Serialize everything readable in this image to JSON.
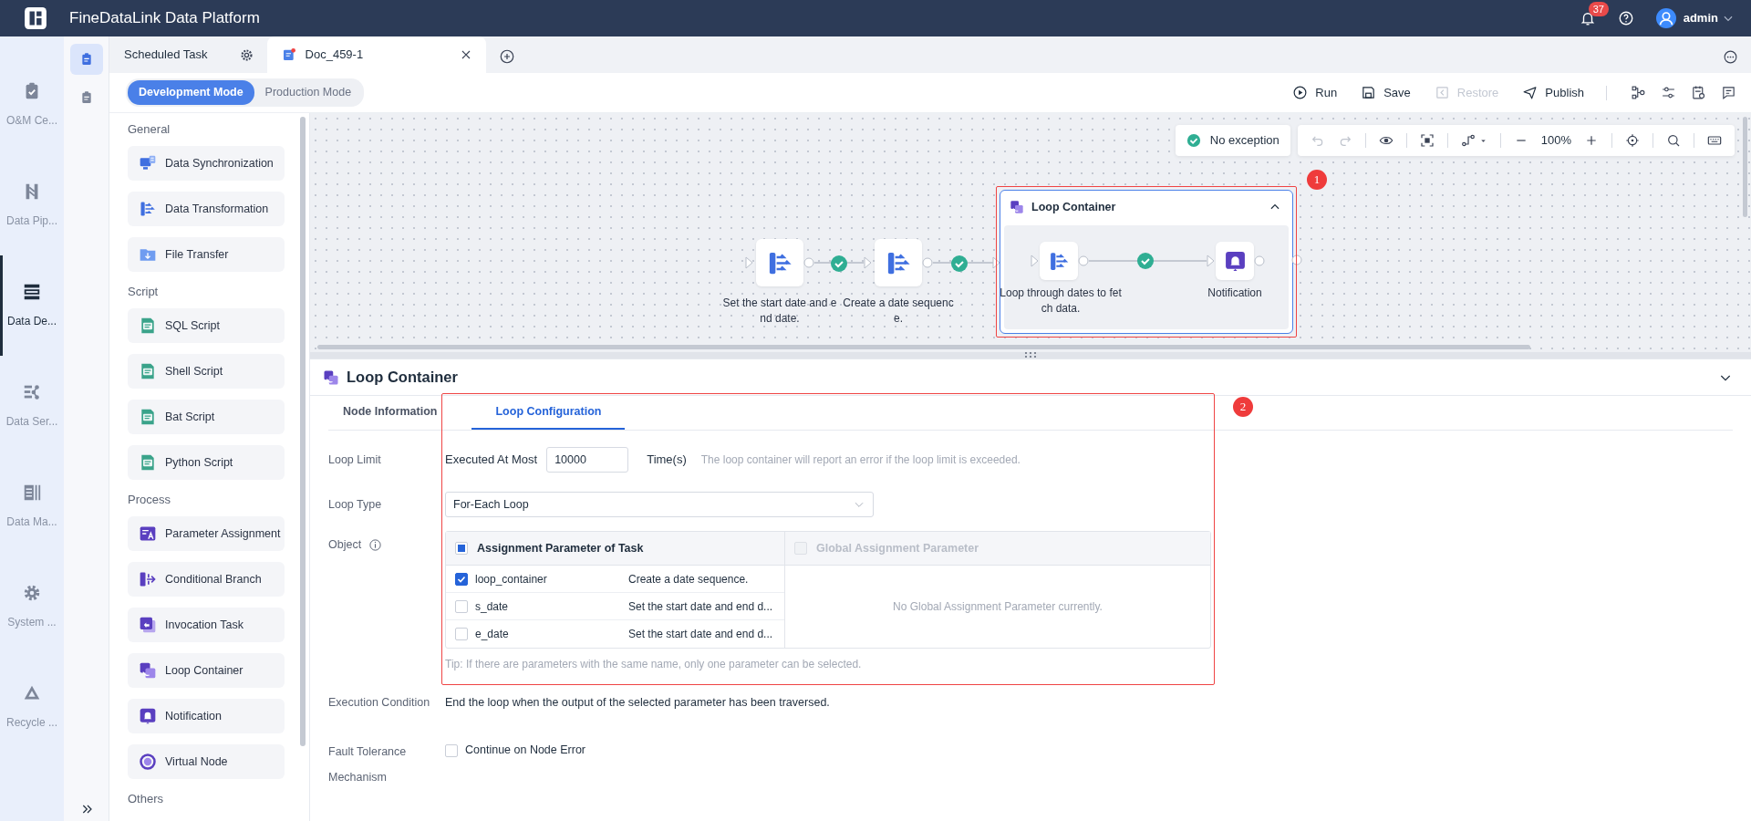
{
  "app": {
    "title": "FineDataLink Data Platform",
    "notification_count": "37",
    "user": "admin"
  },
  "nav": [
    {
      "label": "O&M Ce...",
      "kind": "clipboard",
      "selected": false
    },
    {
      "label": "Data Pip...",
      "kind": "pipeline",
      "selected": false
    },
    {
      "label": "Data De...",
      "kind": "develop",
      "selected": true
    },
    {
      "label": "Data Ser...",
      "kind": "service",
      "selected": false
    },
    {
      "label": "Data Ma...",
      "kind": "columns",
      "selected": false
    },
    {
      "label": "System ...",
      "kind": "gear",
      "selected": false
    },
    {
      "label": "Recycle ...",
      "kind": "recycle",
      "selected": false
    }
  ],
  "rail": [
    {
      "selected": true
    },
    {
      "selected": false
    }
  ],
  "tabs": [
    {
      "label": "Scheduled Task",
      "kind": "settings",
      "selected": false,
      "closable": false
    },
    {
      "label": "Doc_459-1",
      "kind": "document",
      "selected": true,
      "closable": true
    }
  ],
  "modes": [
    {
      "label": "Development Mode",
      "selected": true
    },
    {
      "label": "Production Mode",
      "selected": false
    }
  ],
  "actions": [
    {
      "label": "Run",
      "kind": "run",
      "disabled": false
    },
    {
      "label": "Save",
      "kind": "save",
      "disabled": false
    },
    {
      "label": "Restore",
      "kind": "restore",
      "disabled": true
    },
    {
      "label": "Publish",
      "kind": "publish",
      "disabled": false
    }
  ],
  "palette": [
    {
      "heading": "General",
      "items": [
        {
          "label": "Data Synchronization",
          "kind": "sync"
        },
        {
          "label": "Data Transformation",
          "kind": "transform"
        },
        {
          "label": "File Transfer",
          "kind": "file"
        }
      ]
    },
    {
      "heading": "Script",
      "items": [
        {
          "label": "SQL Script",
          "kind": "script"
        },
        {
          "label": "Shell Script",
          "kind": "script"
        },
        {
          "label": "Bat Script",
          "kind": "script"
        },
        {
          "label": "Python Script",
          "kind": "script"
        }
      ]
    },
    {
      "heading": "Process",
      "items": [
        {
          "label": "Parameter Assignment",
          "kind": "param"
        },
        {
          "label": "Conditional Branch",
          "kind": "branch"
        },
        {
          "label": "Invocation Task",
          "kind": "invoke"
        },
        {
          "label": "Loop Container",
          "kind": "loop"
        },
        {
          "label": "Notification",
          "kind": "notify"
        },
        {
          "label": "Virtual Node",
          "kind": "virtual"
        }
      ]
    },
    {
      "heading": "Others"
    }
  ],
  "canvas": {
    "status": "No exception",
    "zoom": "100%",
    "nodes": [
      {
        "label": "Set the start date and end date.",
        "kind": "transform"
      },
      {
        "label": "Create a date sequence.",
        "kind": "transform"
      }
    ],
    "container": {
      "title": "Loop Container",
      "expanded": true,
      "nodes": [
        {
          "label": "Loop through dates to fetch data.",
          "kind": "transform"
        },
        {
          "label": "Notification",
          "kind": "notify"
        }
      ]
    }
  },
  "annotations": [
    {
      "label": "1"
    },
    {
      "label": "2"
    }
  ],
  "panel": {
    "title": "Loop Container",
    "expanded": true,
    "tabs": [
      {
        "label": "Node Information",
        "selected": false
      },
      {
        "label": "Loop Configuration",
        "selected": true
      }
    ],
    "loop_limit": {
      "label": "Loop Limit",
      "prefix": "Executed At Most",
      "value": "10000",
      "unit": "Time(s)",
      "hint": "The loop container will report an error if the loop limit is exceeded."
    },
    "loop_type": {
      "label": "Loop Type",
      "value": "For-Each Loop"
    },
    "object": {
      "label": "Object",
      "task_header": "Assignment Parameter of Task",
      "task_indeterminate": true,
      "global_header": "Global Assignment Parameter",
      "global_disabled": true,
      "params": [
        {
          "name": "loop_container",
          "source": "Create a date sequence.",
          "checked": true
        },
        {
          "name": "s_date",
          "source": "Set the start date and end d...",
          "checked": false
        },
        {
          "name": "e_date",
          "source": "Set the start date and end d...",
          "checked": false
        }
      ],
      "empty": "No Global Assignment Parameter currently.",
      "tip": "Tip: If there are parameters with the same name, only one parameter can be selected."
    },
    "execution": {
      "label": "Execution Condition",
      "text": "End the loop when the output of the selected parameter has been traversed."
    },
    "fault": {
      "label": "Fault Tolerance Mechanism",
      "option": "Continue on Node Error",
      "checked": false
    }
  }
}
